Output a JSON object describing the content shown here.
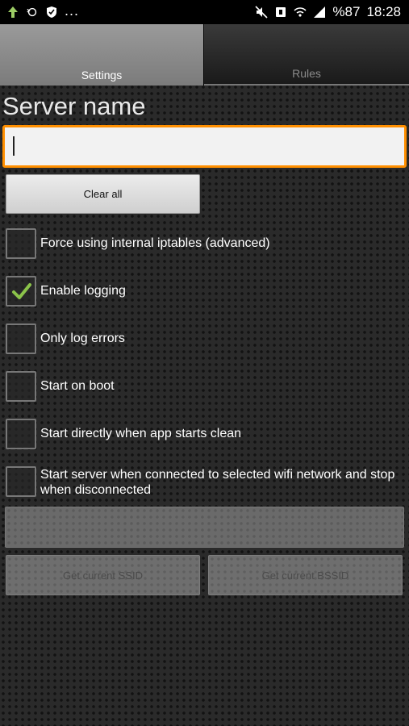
{
  "status_bar": {
    "left_icons": [
      "upload-arrow-icon",
      "sync-icon",
      "shield-icon"
    ],
    "overflow": "...",
    "right_icons": [
      "mute-icon",
      "nfc-icon",
      "wifi-icon",
      "signal-icon"
    ],
    "battery": "%87",
    "time": "18:28"
  },
  "tabs": [
    {
      "label": "Settings",
      "active": true
    },
    {
      "label": "Rules",
      "active": false
    }
  ],
  "server": {
    "label": "Server name",
    "value": "",
    "placeholder": ""
  },
  "buttons": {
    "clear_all": "Clear all",
    "get_ssid": "Get current SSID",
    "get_bssid": "Get current BSSID"
  },
  "options": [
    {
      "label": "Force using internal iptables (advanced)",
      "checked": false
    },
    {
      "label": "Enable logging",
      "checked": true
    },
    {
      "label": "Only log errors",
      "checked": false
    },
    {
      "label": "Start on boot",
      "checked": false
    },
    {
      "label": "Start directly when app starts clean",
      "checked": false
    },
    {
      "label": "Start server when connected to selected wifi network and stop when disconnected",
      "checked": false
    }
  ],
  "colors": {
    "accent_focus": "#ff8f00",
    "check": "#8bc34a"
  }
}
